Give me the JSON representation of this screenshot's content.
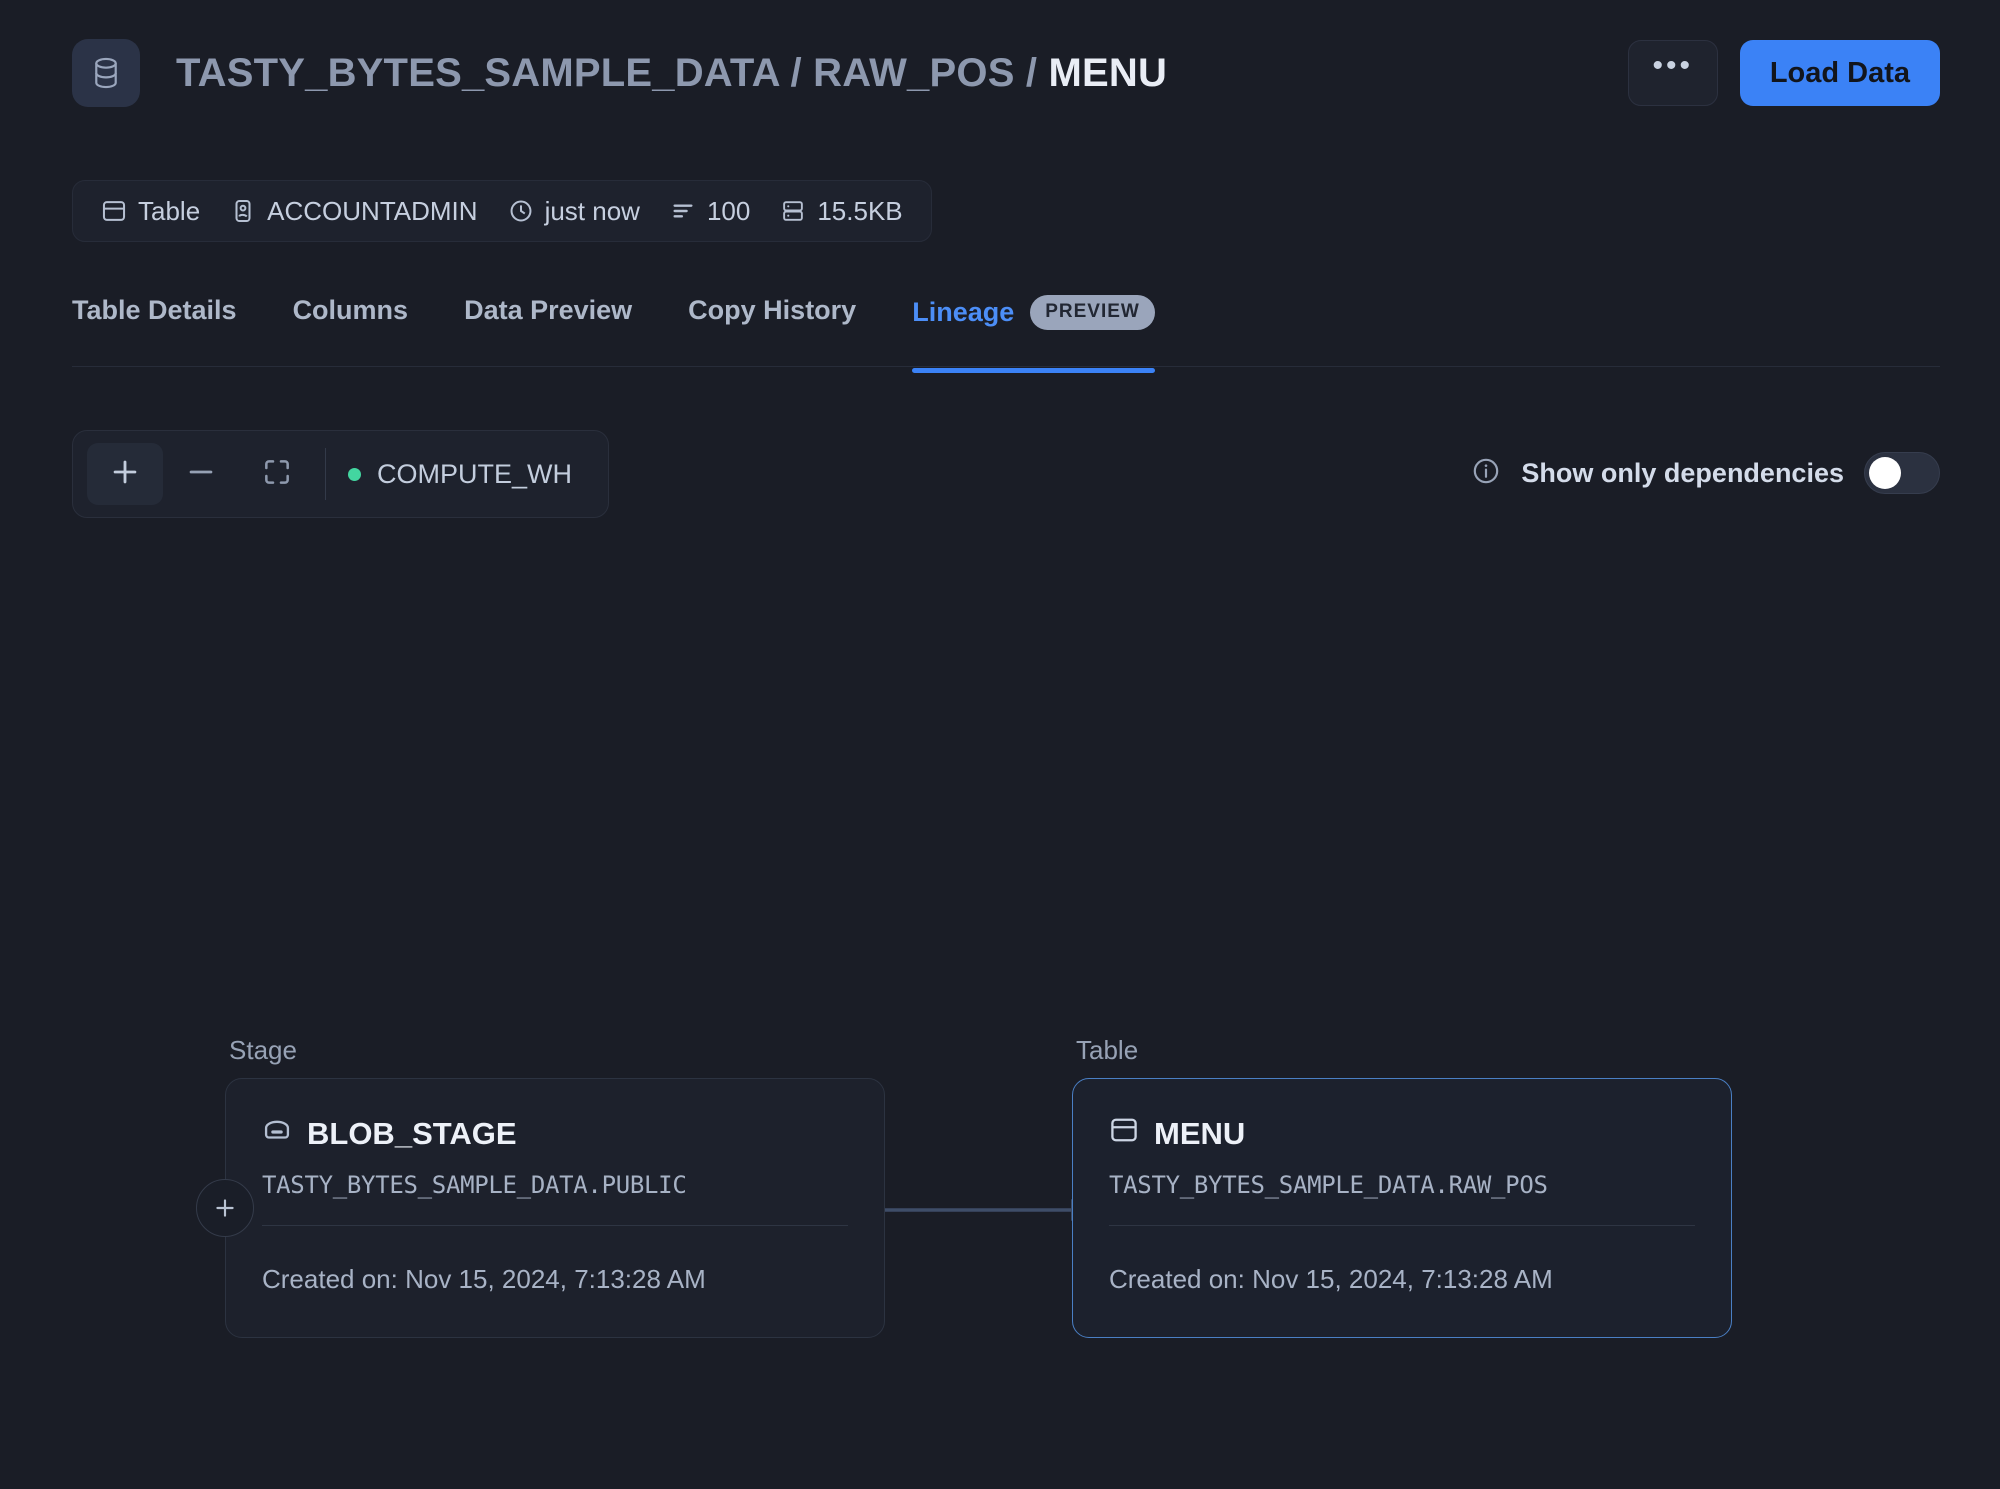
{
  "header": {
    "db_icon": "database-icon",
    "breadcrumb_prefix": "TASTY_BYTES_SAMPLE_DATA / RAW_POS / ",
    "breadcrumb_leaf": "MENU",
    "more_label": "•••",
    "load_data_label": "Load Data",
    "accent_color": "#3b82f6"
  },
  "meta": {
    "items": [
      {
        "icon": "table-icon",
        "label": "Table"
      },
      {
        "icon": "user-card-icon",
        "label": "ACCOUNTADMIN"
      },
      {
        "icon": "clock-icon",
        "label": "just now"
      },
      {
        "icon": "rows-icon",
        "label": "100"
      },
      {
        "icon": "storage-icon",
        "label": "15.5KB"
      }
    ]
  },
  "tabs": {
    "items": [
      {
        "label": "Table Details",
        "active": false
      },
      {
        "label": "Columns",
        "active": false
      },
      {
        "label": "Data Preview",
        "active": false
      },
      {
        "label": "Copy History",
        "active": false
      },
      {
        "label": "Lineage",
        "active": true,
        "badge": "PREVIEW"
      }
    ]
  },
  "toolbar": {
    "zoom_in_icon": "plus-icon",
    "zoom_out_icon": "minus-icon",
    "fit_view_icon": "fit-view-icon",
    "warehouse_name": "COMPUTE_WH",
    "warehouse_status_color": "#43d6a0"
  },
  "dependencies": {
    "info_icon": "info-icon",
    "label": "Show only dependencies",
    "enabled": false
  },
  "lineage": {
    "nodes": [
      {
        "kind": "Stage",
        "icon": "stage-icon",
        "name": "BLOB_STAGE",
        "path": "TASTY_BYTES_SAMPLE_DATA.PUBLIC",
        "created": "Created on: Nov 15, 2024, 7:13:28 AM",
        "selected": false,
        "has_expand_handle": true,
        "expand_icon": "plus-icon"
      },
      {
        "kind": "Table",
        "icon": "table-icon",
        "name": "MENU",
        "path": "TASTY_BYTES_SAMPLE_DATA.RAW_POS",
        "created": "Created on: Nov 15, 2024, 7:13:28 AM",
        "selected": true,
        "has_expand_handle": false
      }
    ],
    "edge": {
      "from": "BLOB_STAGE",
      "to": "MENU",
      "color": "#3e4d68"
    }
  }
}
